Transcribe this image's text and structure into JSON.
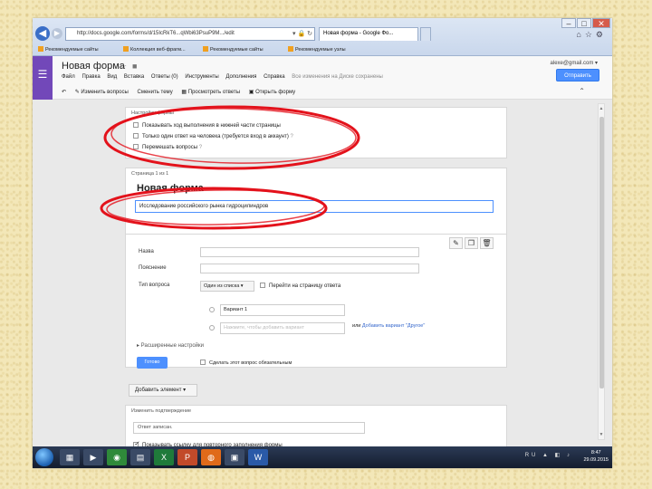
{
  "browser": {
    "address": "http://docs.google.com/forms/d/15IcRkT6...qWbi63PsuP9M.../edit",
    "tab_active": "Новая форма - Google Фо...",
    "tab_inactive": "",
    "favorites": [
      "Рекомендуемые сайты",
      "Коллекция веб-фрагм...",
      "Рекомендуемые сайты",
      "Рекомендуемые узлы"
    ]
  },
  "app": {
    "logo_icon": "forms-menu-icon",
    "form_title": "Новая форма",
    "menu": [
      "Файл",
      "Правка",
      "Вид",
      "Вставка",
      "Ответы (0)",
      "Инструменты",
      "Дополнения",
      "Справка"
    ],
    "saved_status": "Все изменения на Диске сохранены",
    "account": "alexe@gmail.com ▾",
    "send_button": "Отправить",
    "toolbar": [
      "Изменить вопросы",
      "Сменить тему",
      "Просмотреть ответы",
      "Открыть форму"
    ]
  },
  "settings": {
    "label": "Настройки формы",
    "options": [
      {
        "text": "Показывать ход выполнения в нижней части страницы",
        "checked": false
      },
      {
        "text": "Только один ответ на человека (требуется вход в аккаунт)",
        "checked": false
      },
      {
        "text": "Перемешать вопросы",
        "checked": false
      }
    ]
  },
  "page": {
    "label": "Страница 1 из 1",
    "title": "Новая форма",
    "description": "Исследование российского рынка гидроцилиндров"
  },
  "question": {
    "title_label": "Назва",
    "help_label": "Пояснение",
    "type_label": "Тип вопроса",
    "type_value": "Один из списка ▾",
    "goto_label": "Перейти на страницу ответа",
    "options": [
      "Вариант 1",
      "Нажмите, чтобы добавить вариант"
    ],
    "add_other_prefix": "или",
    "add_other_link": "Добавить вариант \"Другое\"",
    "advanced": "▸ Расширенные настройки",
    "done_button": "Готово",
    "required_label": "Сделать этот вопрос обязательным"
  },
  "add_element": "Добавить элемент",
  "confirm": {
    "label": "Изменить подтверждение",
    "input_placeholder": "Ответ записан.",
    "option": "Показывать ссылку для повторного заполнения формы"
  },
  "taskbar": {
    "tray": "RU",
    "time": "8:47",
    "date": "29.09.2015"
  },
  "colors": {
    "accent": "#4d90fe",
    "forms_purple": "#7248b9",
    "annotation_red": "#e3121b"
  }
}
